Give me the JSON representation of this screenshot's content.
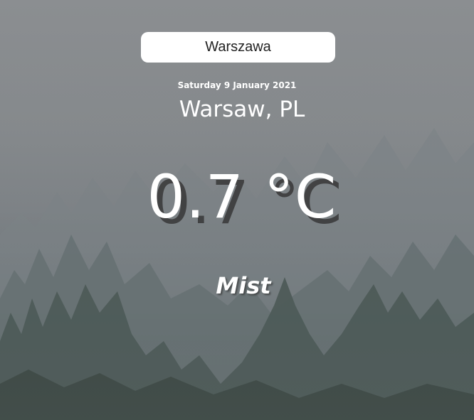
{
  "search": {
    "value": "Warszawa",
    "placeholder": ""
  },
  "weather": {
    "date": "Saturday 9 January 2021",
    "location": "Warsaw, PL",
    "temperature": "0.7 °C",
    "condition": "Mist"
  },
  "colors": {
    "text": "#ffffff",
    "search_background": "#ffffff",
    "temperature_shadow": "#373737",
    "sky": "#8b8e91",
    "forest": "#3d4944"
  },
  "icons": {
    "background": "foggy-forest-image"
  }
}
